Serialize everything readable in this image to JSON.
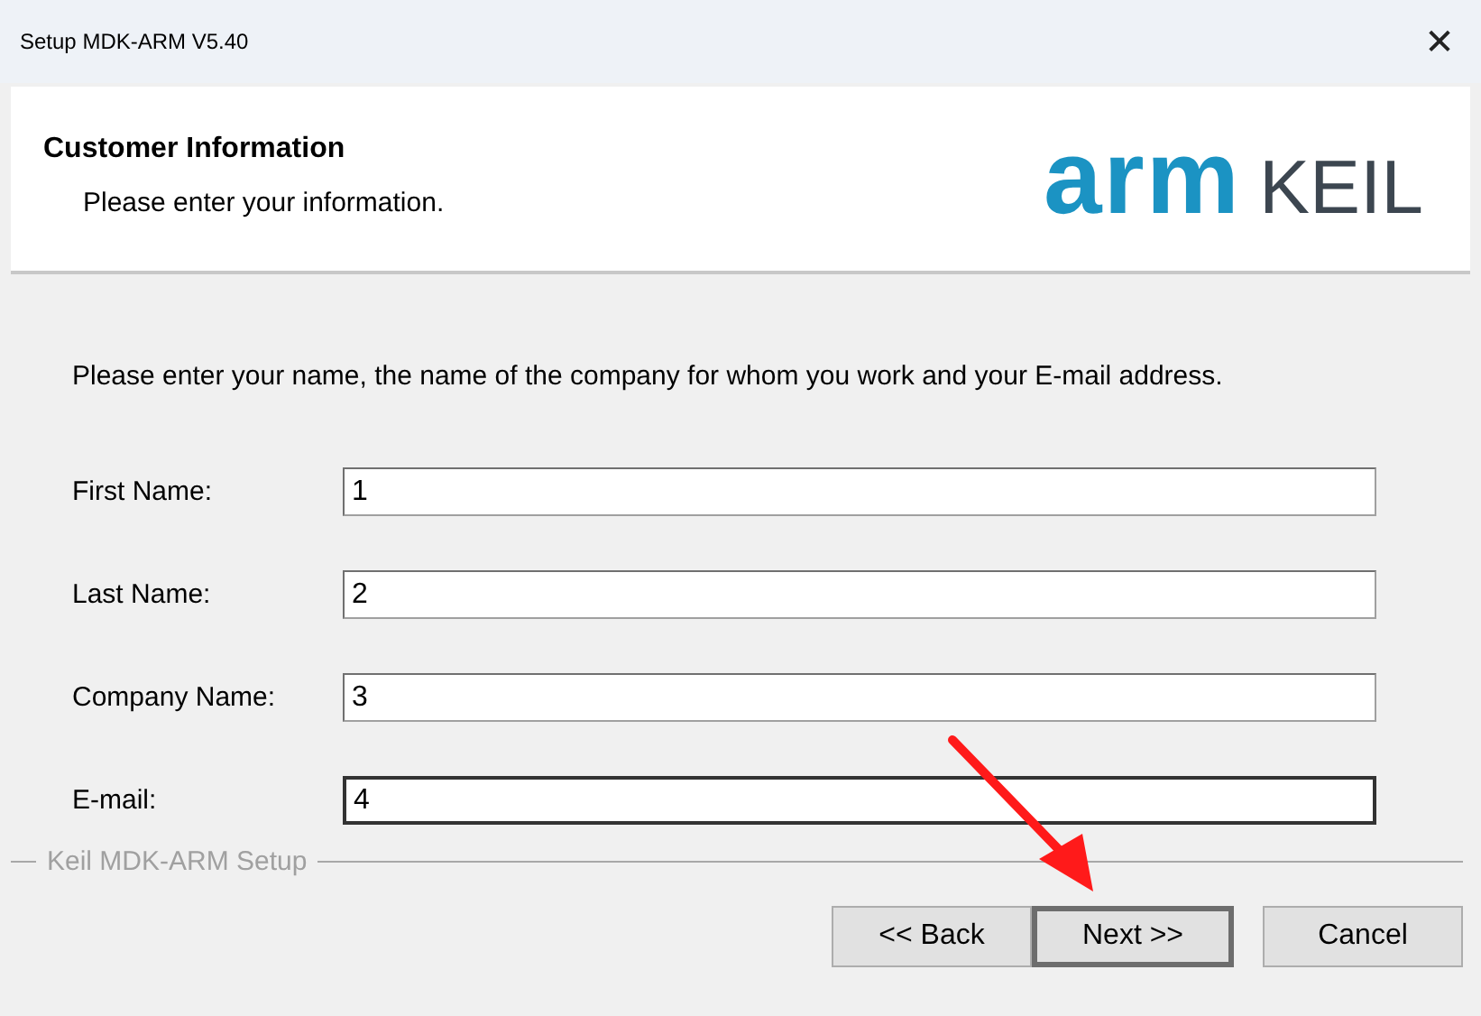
{
  "window": {
    "title": "Setup MDK-ARM V5.40",
    "close": "✕"
  },
  "header": {
    "title": "Customer Information",
    "subtitle": "Please enter your information.",
    "logo": {
      "brand": "arm",
      "product": "KEIL"
    }
  },
  "instruction": "Please enter your name, the name of the company for whom you work and your E-mail address.",
  "fields": [
    {
      "label": "First Name:",
      "value": "1"
    },
    {
      "label": "Last Name:",
      "value": "2"
    },
    {
      "label": "Company Name:",
      "value": "3"
    },
    {
      "label": "E-mail:",
      "value": "4",
      "focused": true
    }
  ],
  "group_label": "Keil MDK-ARM Setup",
  "buttons": [
    {
      "label": "<< Back",
      "default": false
    },
    {
      "label": "Next >>",
      "default": true
    },
    {
      "label": "Cancel",
      "default": false
    }
  ],
  "annotation": {
    "kind": "arrow"
  }
}
